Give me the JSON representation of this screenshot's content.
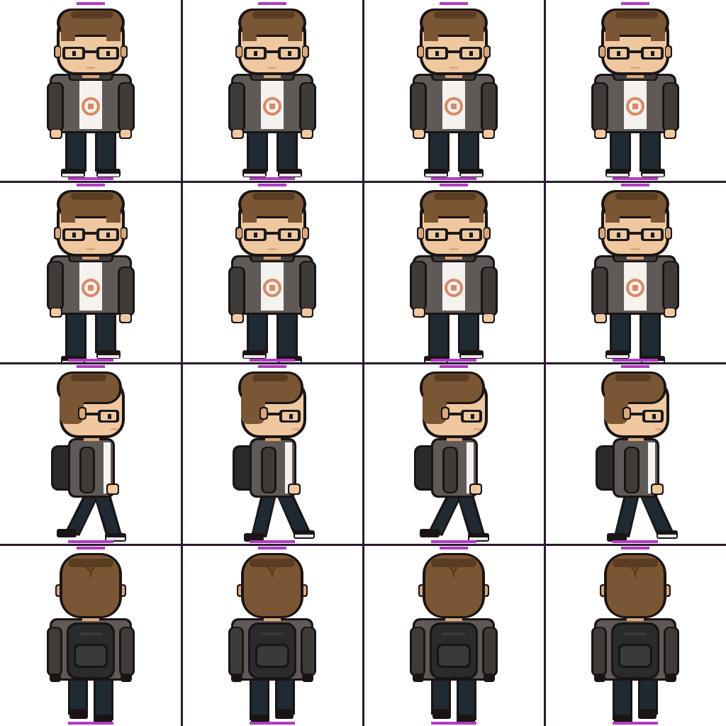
{
  "sheet": {
    "rows": 4,
    "cols": 4,
    "colors": {
      "background": "#ffffff",
      "grid": "#2a1a2e",
      "marker": "#b23ac2",
      "hair": "#7a5634",
      "hair_dark": "#5a3c22",
      "skin": "#f0c8a0",
      "skin_shade": "#d9a77e",
      "glasses": "#1a1a1a",
      "hoodie": "#5f5a57",
      "hoodie_dark": "#3f3b39",
      "shirt": "#f4f1ee",
      "shirt_print": "#d98a64",
      "pants": "#1f2a33",
      "shoes": "#2b2b2b",
      "shoe_sole": "#e8e8e8",
      "backpack": "#2b2b2b",
      "outline": "#1a1414"
    },
    "frames": [
      {
        "row": 0,
        "direction": "front",
        "pose": "idle"
      },
      {
        "row": 0,
        "direction": "front",
        "pose": "idle"
      },
      {
        "row": 0,
        "direction": "front",
        "pose": "idle"
      },
      {
        "row": 0,
        "direction": "front",
        "pose": "idle"
      },
      {
        "row": 1,
        "direction": "front",
        "pose": "walk-a"
      },
      {
        "row": 1,
        "direction": "front",
        "pose": "walk-b"
      },
      {
        "row": 1,
        "direction": "front",
        "pose": "walk-a"
      },
      {
        "row": 1,
        "direction": "front",
        "pose": "walk-b"
      },
      {
        "row": 2,
        "direction": "side",
        "pose": "walk-a"
      },
      {
        "row": 2,
        "direction": "side",
        "pose": "walk-b"
      },
      {
        "row": 2,
        "direction": "side",
        "pose": "walk-a"
      },
      {
        "row": 2,
        "direction": "side",
        "pose": "walk-b"
      },
      {
        "row": 3,
        "direction": "back",
        "pose": "walk-a"
      },
      {
        "row": 3,
        "direction": "back",
        "pose": "walk-b"
      },
      {
        "row": 3,
        "direction": "back",
        "pose": "walk-a"
      },
      {
        "row": 3,
        "direction": "back",
        "pose": "walk-b"
      }
    ]
  }
}
